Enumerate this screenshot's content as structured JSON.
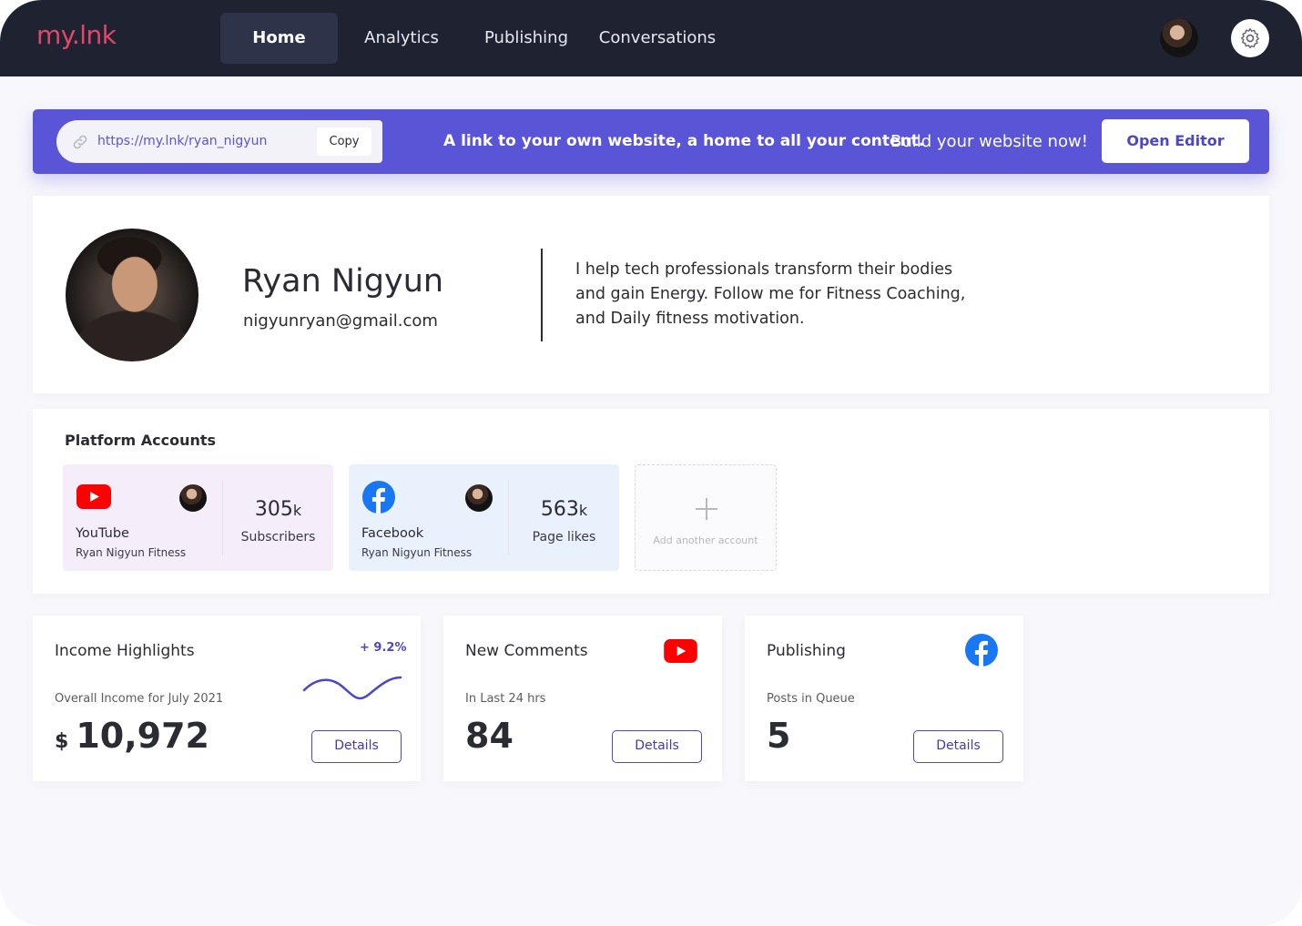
{
  "app": {
    "logo_part1": "my.",
    "logo_part2": "lnk"
  },
  "nav": {
    "tabs": [
      {
        "label": "Home",
        "active": true
      },
      {
        "label": "Analytics",
        "active": false
      },
      {
        "label": "Publishing",
        "active": false
      },
      {
        "label": "Conversations",
        "active": false
      }
    ],
    "settings_icon": "gear-icon",
    "avatar_icon": "user-avatar"
  },
  "banner": {
    "url": "https://my.lnk/ryan_nigyun",
    "copy_label": "Copy",
    "tagline": "A link to your own website, a home to all your content.",
    "cta_text": "Build your website now!",
    "button_label": "Open Editor",
    "color": "#5a55d6"
  },
  "profile": {
    "name": "Ryan Nigyun",
    "email": "nigyunryan@gmail.com",
    "bio": "I help tech professionals transform their bodies and gain Energy. Follow me for Fitness Coaching, and Daily fitness motivation."
  },
  "platforms": {
    "title": "Platform Accounts",
    "accounts": [
      {
        "platform": "YouTube",
        "account_name": "Ryan Nigyun Fitness",
        "stat_value": "305",
        "stat_unit": "k",
        "stat_label": "Subscribers",
        "icon": "youtube-icon"
      },
      {
        "platform": "Facebook",
        "account_name": "Ryan Nigyun Fitness",
        "stat_value": "563",
        "stat_unit": "k",
        "stat_label": "Page likes",
        "icon": "facebook-icon"
      }
    ],
    "add_label": "Add another account"
  },
  "metrics": {
    "income": {
      "title": "Income Highlights",
      "change": "+ 9.2%",
      "subtitle": "Overall Income for July 2021",
      "currency": "$",
      "value": "10,972",
      "details_label": "Details"
    },
    "comments": {
      "title": "New Comments",
      "subtitle": "In Last 24 hrs",
      "value": "84",
      "details_label": "Details",
      "icon": "youtube-icon"
    },
    "publishing": {
      "title": "Publishing",
      "subtitle": "Posts in Queue",
      "value": "5",
      "details_label": "Details",
      "icon": "facebook-icon"
    }
  },
  "colors": {
    "accent": "#5a55d6",
    "nav_bg": "#1f2230",
    "logo": "#e2486a",
    "youtube": "#ff0000",
    "facebook": "#1877f2"
  }
}
